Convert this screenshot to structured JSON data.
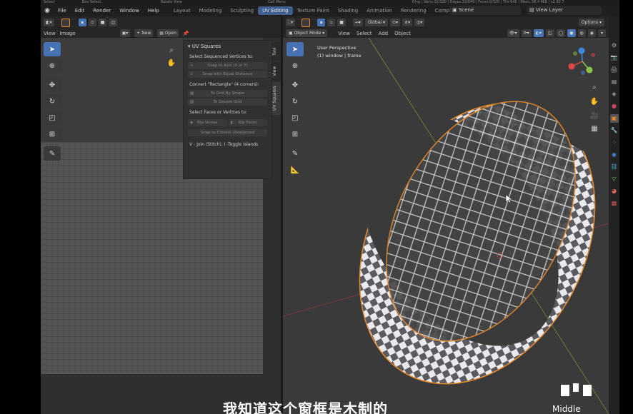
{
  "status": {
    "left": [
      "Select",
      "Box Select",
      "Rotate View",
      "Call Menu"
    ],
    "right": "Ring | Verts:32/320 | Edges:32/640 | Faces:0/320 | Tris:640 | Mem: 58.4 MiB | v2.82.7"
  },
  "menu": [
    "File",
    "Edit",
    "Render",
    "Window",
    "Help"
  ],
  "workspaces": [
    {
      "label": "Layout",
      "active": false
    },
    {
      "label": "Modeling",
      "active": false
    },
    {
      "label": "Sculpting",
      "active": false
    },
    {
      "label": "UV Editing",
      "active": true
    },
    {
      "label": "Texture Paint",
      "active": false
    },
    {
      "label": "Shading",
      "active": false
    },
    {
      "label": "Animation",
      "active": false
    },
    {
      "label": "Rendering",
      "active": false
    },
    {
      "label": "Compositing",
      "active": false
    }
  ],
  "scene_label": "Scene",
  "view_layer_label": "View Layer",
  "uv_editor": {
    "menu": [
      "View",
      "Image"
    ],
    "new_button": "New",
    "open_button": "Open"
  },
  "uv_panel": {
    "title": "UV Squares",
    "section1": "Select Sequenced Vertices to:",
    "snap_axis": "Snap to Axis (X or Y)",
    "snap_equal": "Snap with Equal Distance",
    "section2": "Convert \"Rectangle\" (4 corners):",
    "grid_shape": "To Grid By Shape",
    "square_grid": "To Square Grid",
    "section3": "Select Faces or Vertices to:",
    "rip_vertex": "Rip Vertex",
    "rip_faces": "Rip Faces",
    "snap_closest": "Snap to Closest Unselected",
    "hint": "V - Join (Stitch), I -Toggle Islands",
    "tabs": [
      "Tool",
      "View",
      "UV Squares"
    ]
  },
  "viewport": {
    "mode": "Object Mode",
    "menu": [
      "View",
      "Select",
      "Add",
      "Object"
    ],
    "orientation": "Global",
    "options": "Options",
    "perspective_label": "User Perspective",
    "object_label": "(1) window | frame"
  },
  "overlay": {
    "subtitle": "我知道这个窗框是木制的",
    "key_label": "Middle"
  },
  "colors": {
    "accent": "#4772b3",
    "selection_outline": "#e88a2b",
    "axis_x": "#e04848",
    "axis_y": "#8bc34a",
    "axis_z": "#3f88e0"
  }
}
